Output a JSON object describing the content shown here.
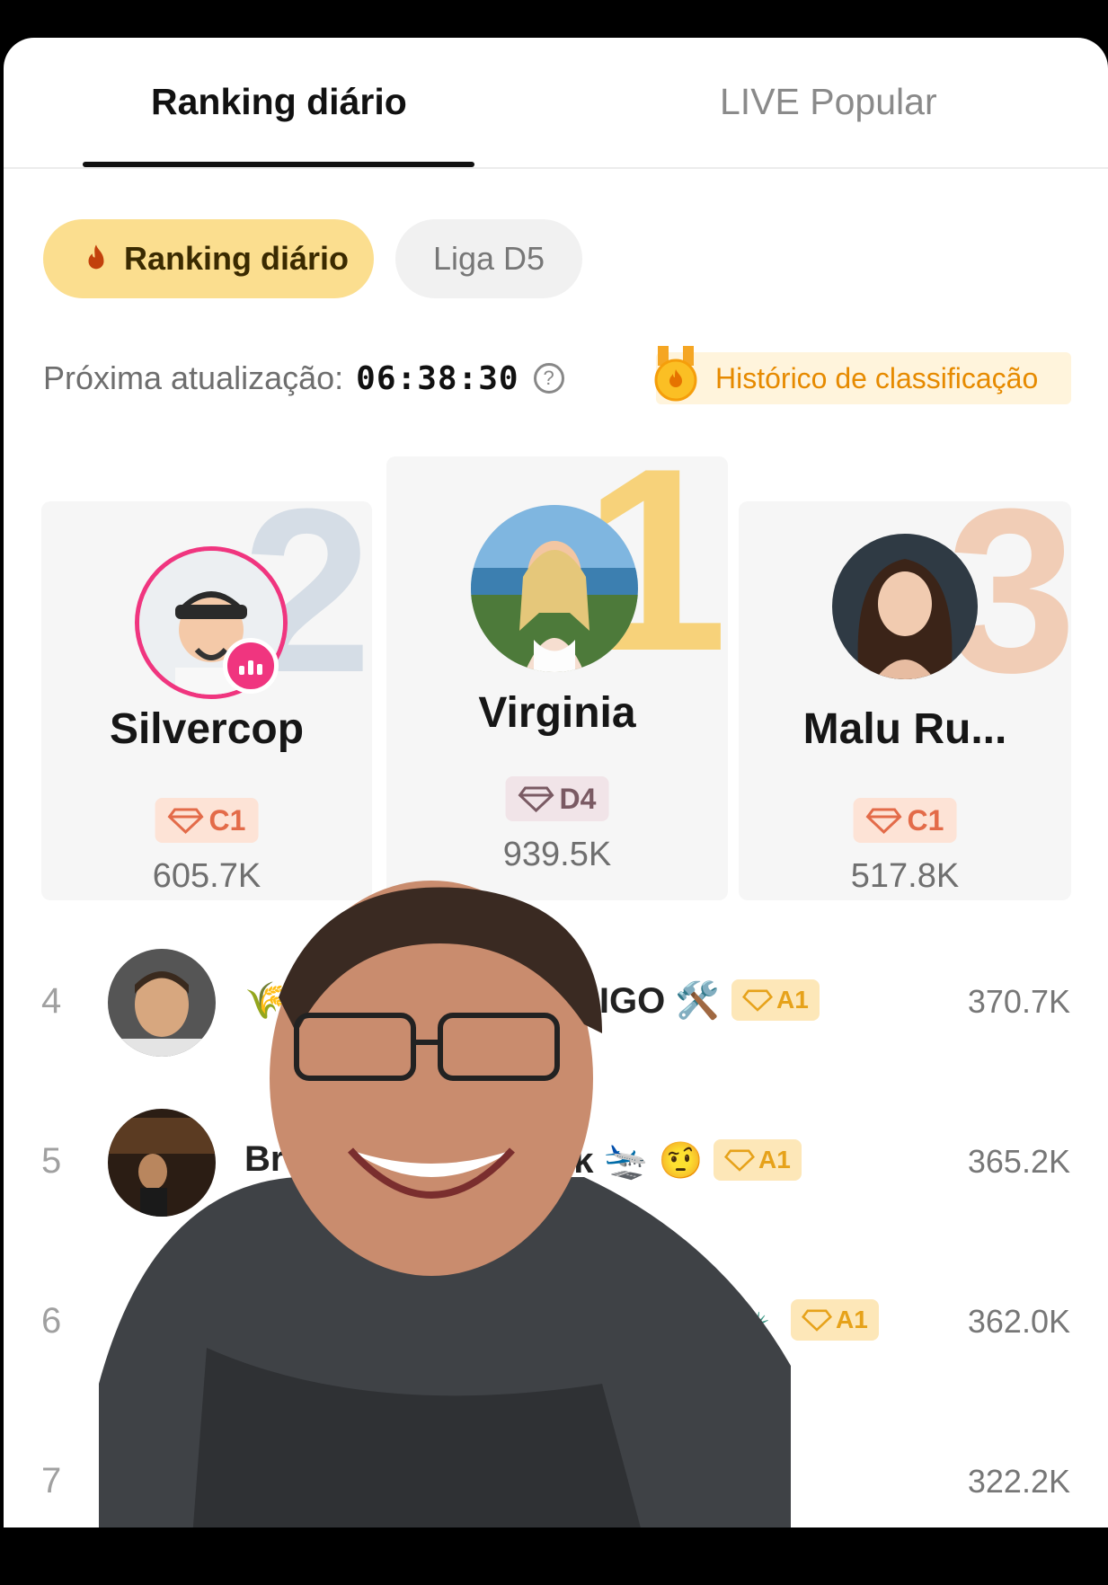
{
  "tabs": {
    "daily": "Ranking diário",
    "popular": "LIVE Popular"
  },
  "chips": {
    "daily": "Ranking diário",
    "league": "Liga D5"
  },
  "update": {
    "label": "Próxima atualização:",
    "time": "06:38:30",
    "help": "?"
  },
  "history": {
    "label": "Histórico de classificação"
  },
  "podium": [
    {
      "rank": "1",
      "name": "Virginia",
      "tier": "D4",
      "score": "939.5K"
    },
    {
      "rank": "2",
      "name": "Silvercop",
      "tier": "C1",
      "score": "605.7K",
      "live": true
    },
    {
      "rank": "3",
      "name": "Malu Ru...",
      "tier": "C1",
      "score": "517.8K"
    }
  ],
  "list": [
    {
      "rank": "4",
      "name": "🌾 E",
      "name_tail": "RIGO 🛠️",
      "tier": "A1",
      "score": "370.7K"
    },
    {
      "rank": "5",
      "name": "Brun",
      "name_tail": "ck 🛬 🤨",
      "tier": "A1",
      "score": "365.2K"
    },
    {
      "rank": "6",
      "name": "",
      "name_tail": "🗽",
      "tier": "A1",
      "score": "362.0K"
    },
    {
      "rank": "7",
      "name": "",
      "name_tail": "",
      "tier": "",
      "score": "322.2K"
    }
  ],
  "colors": {
    "accent_pink": "#f0357f",
    "chip_yellow": "#fbde8f",
    "history_orange": "#e68a00"
  }
}
